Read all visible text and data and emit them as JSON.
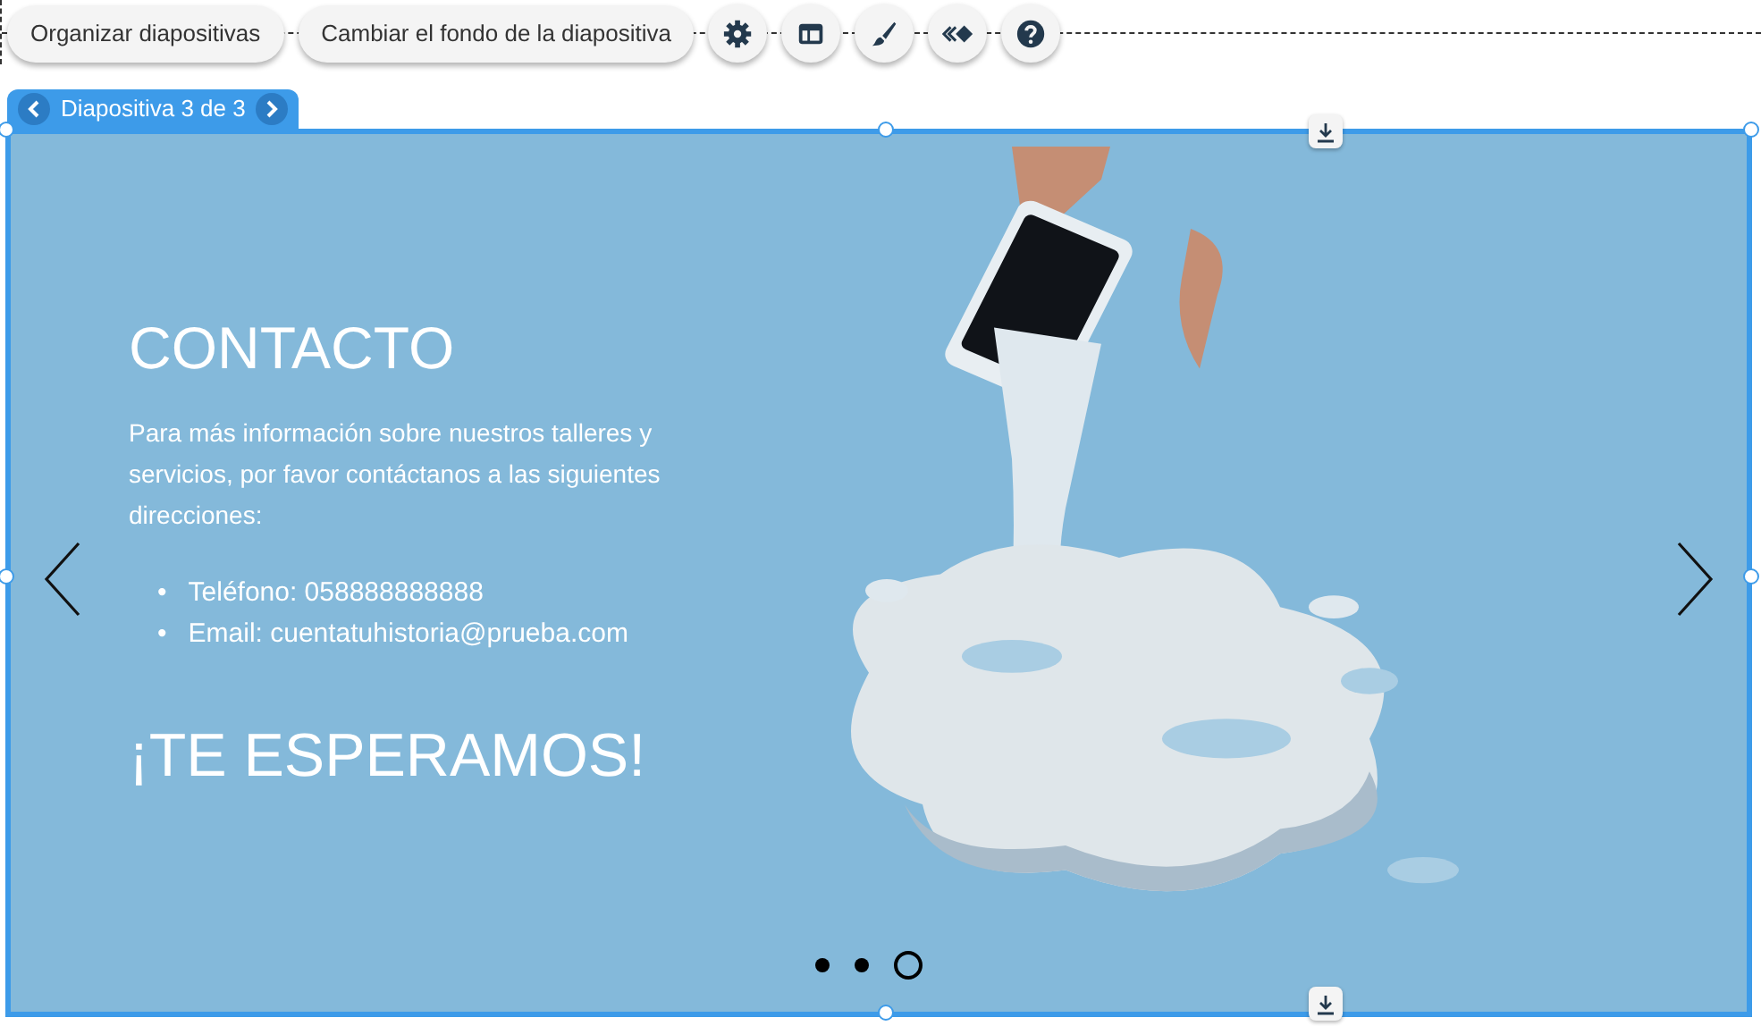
{
  "toolbar": {
    "buttons": [
      {
        "label": "Organizar diapositivas"
      },
      {
        "label": "Cambiar el fondo de la diapositiva"
      }
    ],
    "icon_buttons": [
      {
        "kind": "settings"
      },
      {
        "kind": "layout"
      },
      {
        "kind": "brush"
      },
      {
        "kind": "animation"
      },
      {
        "kind": "help"
      }
    ]
  },
  "slide_tab": {
    "label": "Diapositiva 3 de 3"
  },
  "slide": {
    "title": "CONTACTO",
    "intro": "Para más información sobre nuestros talleres y servicios, por favor contáctanos a las siguientes direcciones:",
    "list": [
      {
        "bullet": "•",
        "text": "Teléfono: 058888888888"
      },
      {
        "bullet": "•",
        "text": "Email: cuentatuhistoria@prueba.com"
      }
    ],
    "closing": "¡TE ESPERAMOS!",
    "dots": [
      {
        "selected": false
      },
      {
        "selected": false
      },
      {
        "selected": true
      }
    ]
  }
}
